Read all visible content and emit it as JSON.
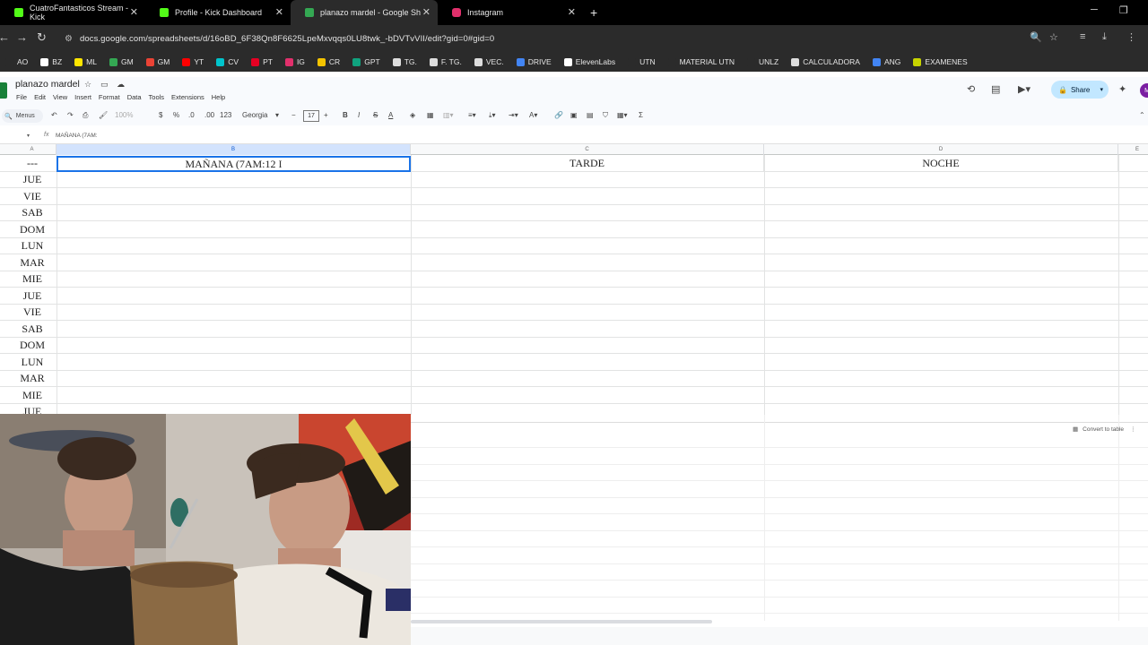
{
  "browser": {
    "tabs": [
      {
        "title": "CuatroFantasticos Stream - Kick",
        "active": false,
        "icon_color": "#53fc18"
      },
      {
        "title": "Profile - Kick Dashboard",
        "active": false,
        "icon_color": "#53fc18"
      },
      {
        "title": "planazo mardel - Google Sheets",
        "active": true,
        "icon_color": "#34a853"
      },
      {
        "title": "Instagram",
        "active": false,
        "icon_color": "#e1306c"
      }
    ],
    "url": "docs.google.com/spreadsheets/d/16oBD_6F38Qn8F6625LpeMxvqqs0LU8twk_-bDVTvVII/edit?gid=0#gid=0",
    "bookmarks": [
      {
        "label": "AO",
        "icon_color": "#2b2b2b"
      },
      {
        "label": "BZ",
        "icon_color": "#ffffff"
      },
      {
        "label": "ML",
        "icon_color": "#ffe600"
      },
      {
        "label": "GM",
        "icon_color": "#34a853"
      },
      {
        "label": "GM",
        "icon_color": "#ea4335"
      },
      {
        "label": "YT",
        "icon_color": "#ff0000"
      },
      {
        "label": "CV",
        "icon_color": "#00c4cc"
      },
      {
        "label": "PT",
        "icon_color": "#e60023"
      },
      {
        "label": "IG",
        "icon_color": "#e1306c"
      },
      {
        "label": "CR",
        "icon_color": "#f5c400"
      },
      {
        "label": "GPT",
        "icon_color": "#10a37f"
      },
      {
        "label": "TG.",
        "icon_color": "#dddddd"
      },
      {
        "label": "F. TG.",
        "icon_color": "#dddddd"
      },
      {
        "label": "VEC.",
        "icon_color": "#dddddd"
      },
      {
        "label": "DRIVE",
        "icon_color": "#4285f4"
      },
      {
        "label": "ElevenLabs",
        "icon_color": "#ffffff"
      },
      {
        "label": "UTN",
        "icon_color": "#2b2b2b"
      },
      {
        "label": "MATERIAL UTN",
        "icon_color": "#2b2b2b"
      },
      {
        "label": "UNLZ",
        "icon_color": "#2b2b2b"
      },
      {
        "label": "CALCULADORA",
        "icon_color": "#dddddd"
      },
      {
        "label": "ANG",
        "icon_color": "#4285f4"
      },
      {
        "label": "EXAMENES",
        "icon_color": "#c8d400"
      }
    ]
  },
  "sheets": {
    "doc_title": "planazo mardel",
    "menu": [
      "File",
      "Edit",
      "View",
      "Insert",
      "Format",
      "Data",
      "Tools",
      "Extensions",
      "Help"
    ],
    "share_label": "Share",
    "avatar_letter": "M",
    "toolbar": {
      "menus_label": "Menus",
      "zoom": "100%",
      "currency": "$",
      "percent": "%",
      "dec_decrease": ".0",
      "dec_increase": ".00",
      "number_format": "123",
      "font": "Georgia",
      "font_size": "17"
    },
    "formula_text": "MAÑANA (7AM:",
    "columns": [
      "A",
      "B",
      "C",
      "D",
      "E"
    ],
    "selected_column": "B",
    "header_row": {
      "a": "---",
      "b_editing": "MAÑANA (7AM:12",
      "c": "TARDE",
      "d": "NOCHE"
    },
    "days": [
      "JUE",
      "VIE",
      "SAB",
      "DOM",
      "LUN",
      "MAR",
      "MIE",
      "JUE",
      "VIE",
      "SAB",
      "DOM",
      "LUN",
      "MAR",
      "MIE",
      "JUE"
    ],
    "convert_to_table": "Convert to table"
  },
  "colors": {
    "accent_blue": "#1a73e8",
    "selected_header": "#d3e3fd",
    "share_bg": "#c2e7ff"
  }
}
